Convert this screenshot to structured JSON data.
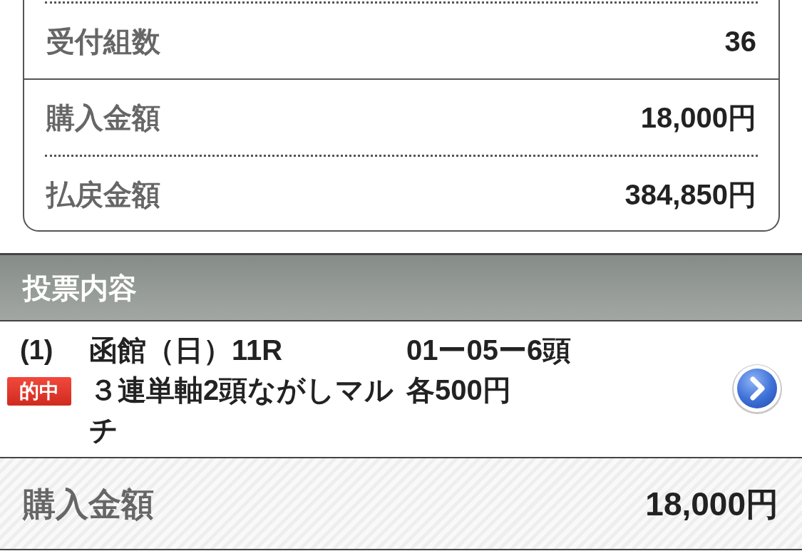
{
  "summary": {
    "groups": [
      {
        "rows": [
          {
            "label": "受付組数",
            "value": "36"
          }
        ]
      },
      {
        "rows": [
          {
            "label": "購入金額",
            "value": "18,000円"
          },
          {
            "label": "払戻金額",
            "value": "384,850円"
          }
        ]
      }
    ]
  },
  "section": {
    "title": "投票内容"
  },
  "bets": [
    {
      "number": "(1)",
      "badge": "的中",
      "race": "函館（日）11R",
      "combination": "01ー05ー6頭",
      "bet_type": "３連単軸2頭ながしマルチ",
      "amount": "各500円"
    }
  ],
  "total": {
    "label": "購入金額",
    "value": "18,000円"
  }
}
